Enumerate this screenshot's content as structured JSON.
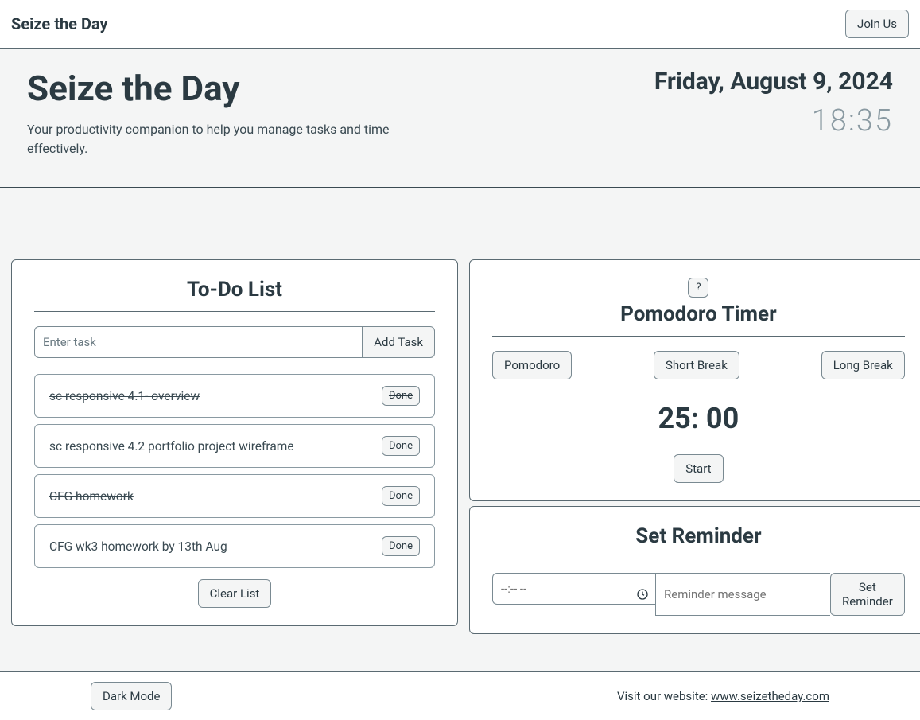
{
  "topbar": {
    "title": "Seize the Day",
    "join_label": "Join Us"
  },
  "header": {
    "title": "Seize the Day",
    "subtitle": "Your productivity companion to help you manage tasks and time effectively.",
    "date": "Friday, August 9, 2024",
    "time": "18:35"
  },
  "todo": {
    "title": "To-Do List",
    "input_placeholder": "Enter task",
    "add_label": "Add Task",
    "done_label": "Done",
    "clear_label": "Clear List",
    "tasks": [
      {
        "text": "sc responsive 4.1- overview",
        "done": true
      },
      {
        "text": "sc responsive 4.2 portfolio project wireframe",
        "done": false
      },
      {
        "text": "CFG homework",
        "done": true
      },
      {
        "text": "CFG wk3 homework by 13th Aug",
        "done": false
      }
    ]
  },
  "pomodoro": {
    "help_label": "?",
    "title": "Pomodoro Timer",
    "mode_pomodoro": "Pomodoro",
    "mode_short": "Short Break",
    "mode_long": "Long Break",
    "time_display": "25: 00",
    "start_label": "Start"
  },
  "reminder": {
    "title": "Set Reminder",
    "time_placeholder": "--:-- --",
    "message_placeholder": "Reminder message",
    "set_label": "Set Reminder"
  },
  "footer": {
    "dark_mode_label": "Dark Mode",
    "visit_prefix": "Visit our website: ",
    "link_text": "www.seizetheday.com"
  }
}
